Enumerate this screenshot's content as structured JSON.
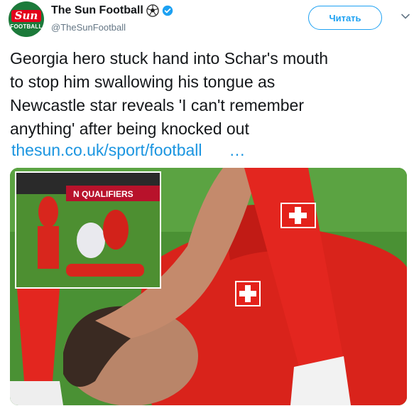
{
  "account": {
    "display_name": "The Sun Football",
    "handle": "@TheSunFootball",
    "avatar_logo": "Sun",
    "avatar_subtitle": "FOOTBALL"
  },
  "actions": {
    "follow_label": "Читать"
  },
  "tweet": {
    "text": "Georgia hero stuck hand into Schar's mouth\nto stop him swallowing his tongue as\nNewcastle star reveals 'I can't remember\nanything' after being knocked out",
    "link": "thesun.co.uk/sport/football",
    "ellipsis": "…"
  },
  "media": {
    "inset_banner": "N QUALIFIERS"
  },
  "icons": {
    "ball": "soccer-ball-icon",
    "verified": "verified-badge-icon",
    "chevron": "chevron-down-icon"
  },
  "colors": {
    "brand_green": "#1c7a3a",
    "brand_red": "#e3001b",
    "link_blue": "#1b95e0",
    "follow_blue": "#1da1f2",
    "muted": "#657786"
  }
}
